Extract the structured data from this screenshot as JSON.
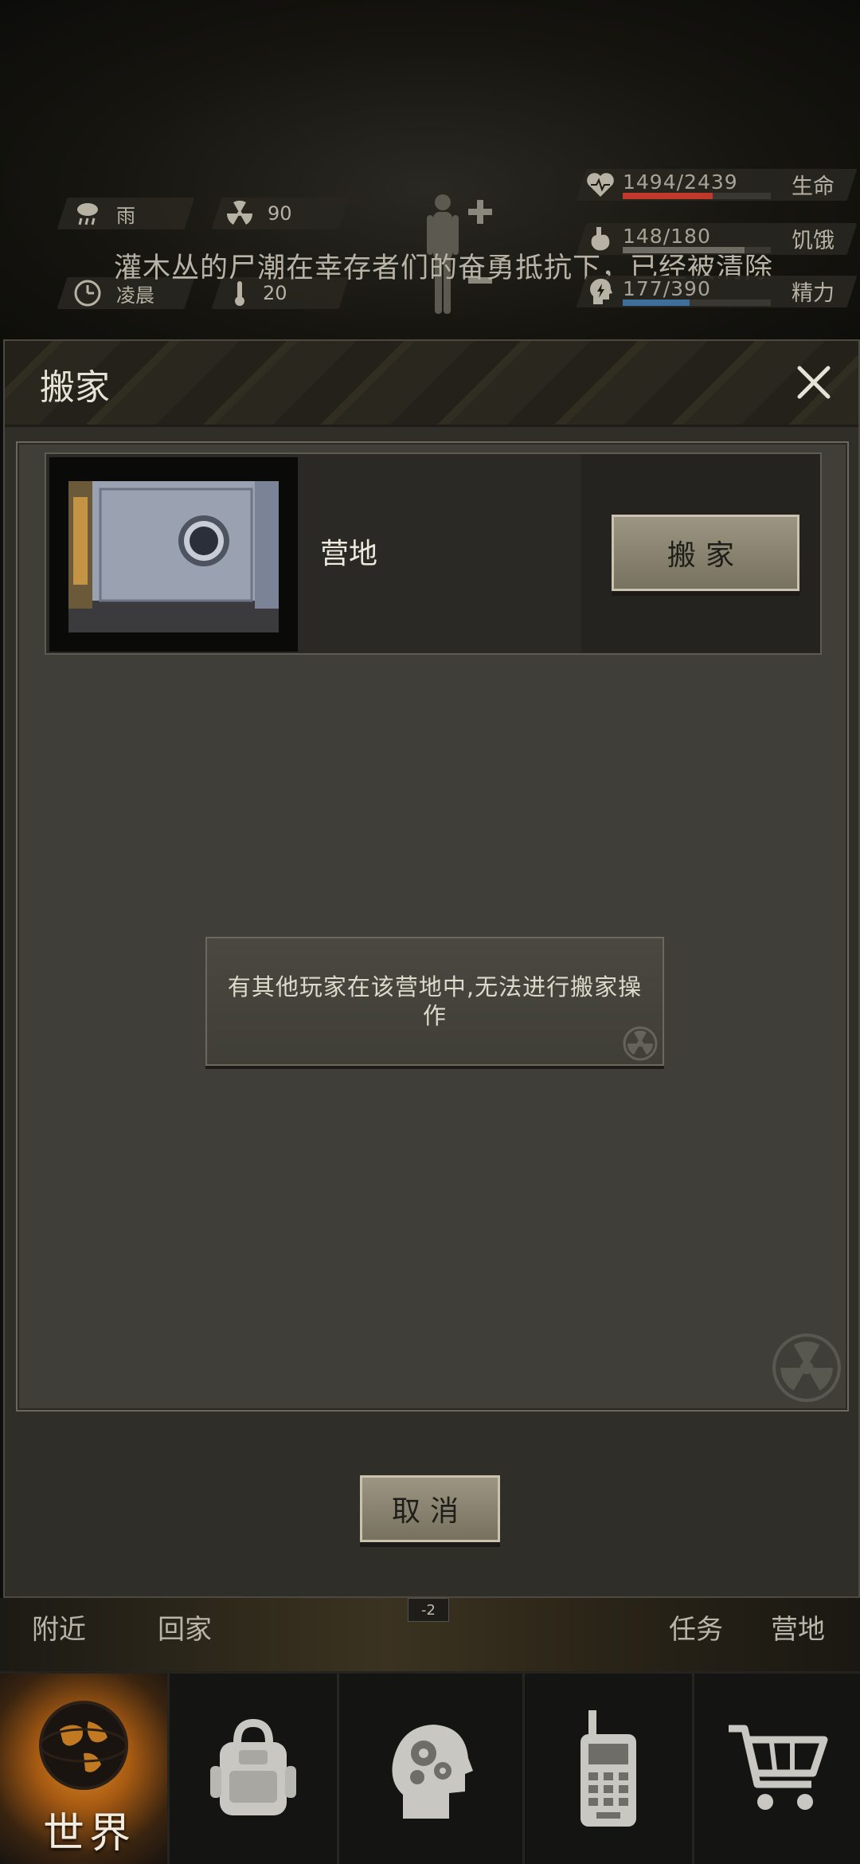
{
  "hud": {
    "weather": "雨",
    "radiation": "90",
    "time_of_day": "凌晨",
    "temperature": "20",
    "notice": "灌木丛的尸潮在幸存者们的奋勇抵抗下，已经被清除",
    "stats": [
      {
        "value": "1494/2439",
        "label": "生命",
        "icon": "heart-icon",
        "fill": 0.61,
        "color": "#c0392b"
      },
      {
        "value": "148/180",
        "label": "饥饿",
        "icon": "stomach-icon",
        "fill": 0.82,
        "color": "#6e6b62"
      },
      {
        "value": "177/390",
        "label": "精力",
        "icon": "energy-head-icon",
        "fill": 0.45,
        "color": "#3d6f9a"
      }
    ]
  },
  "dialog": {
    "title": "搬家",
    "close_icon": "close-icon",
    "camp": {
      "name": "营地",
      "button": "搬家"
    },
    "toast": "有其他玩家在该营地中,无法进行搬家操作",
    "cancel": "取消"
  },
  "nav_strip": {
    "items": [
      "附近",
      "回家",
      "任务",
      "营地"
    ],
    "level": "-2"
  },
  "tabs": {
    "world": "世界",
    "icons": [
      "globe-icon",
      "backpack-icon",
      "head-gears-icon",
      "radio-icon",
      "cart-icon"
    ]
  },
  "colors": {
    "button_face": "#8a8572",
    "health": "#c0392b",
    "energy": "#3d6f9a",
    "world_tab_accent": "#e18a22"
  }
}
